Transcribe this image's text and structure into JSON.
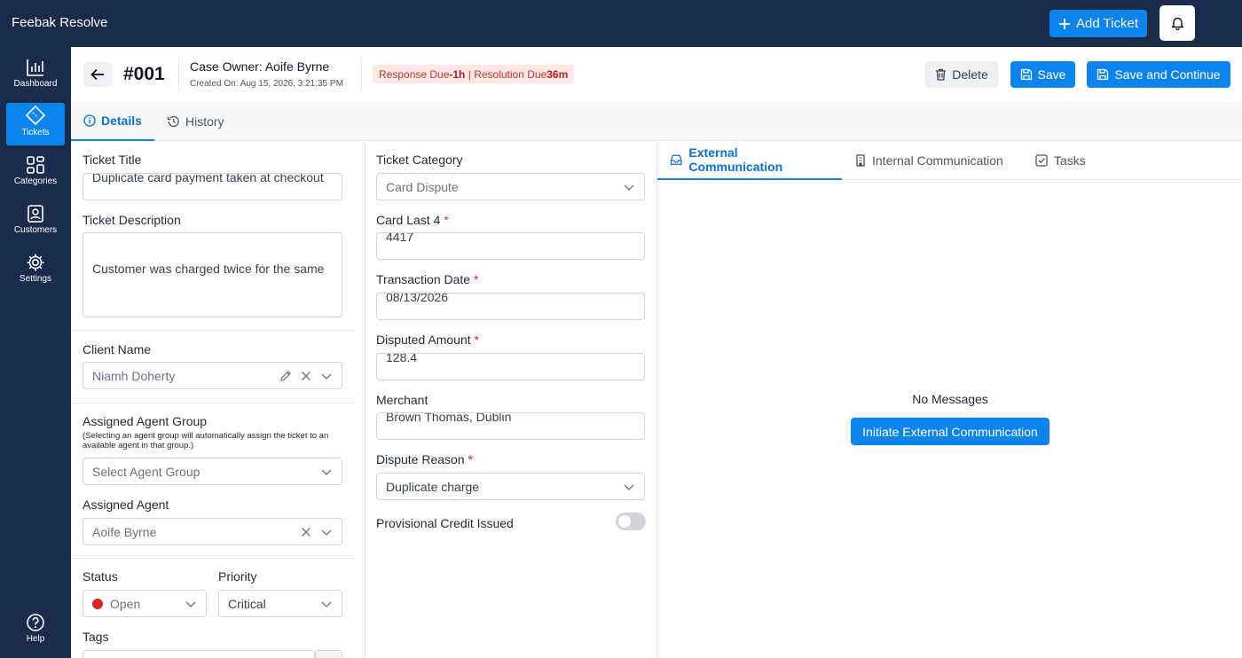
{
  "app": {
    "title": "Feebak Resolve"
  },
  "topbar": {
    "add_ticket_label": "Add Ticket"
  },
  "sidebar": {
    "items": [
      {
        "label": "Dashboard"
      },
      {
        "label": "Tickets"
      },
      {
        "label": "Categories"
      },
      {
        "label": "Customers"
      },
      {
        "label": "Settings"
      }
    ],
    "help_label": "Help"
  },
  "header": {
    "ticket_id": "#001",
    "case_owner": "Case Owner: Aoife Byrne",
    "created_on": "Created On: Aug 15, 2026, 3:21:35 PM",
    "response_due_label": "Response Due ",
    "response_due_value": "-1h",
    "separator": " | ",
    "resolution_due_label": "Resolution Due ",
    "resolution_due_value": "36m",
    "delete_label": "Delete",
    "save_label": "Save",
    "save_continue_label": "Save and Continue"
  },
  "tabs": {
    "details": "Details",
    "history": "History"
  },
  "form": {
    "ticket_title_label": "Ticket Title",
    "ticket_title_value": "Duplicate card payment taken at checkout",
    "ticket_description_label": "Ticket Description",
    "ticket_description_value": "Customer was charged twice for the same",
    "client_name_label": "Client Name",
    "client_name_value": "Niamh Doherty",
    "agent_group_label": "Assigned Agent Group",
    "agent_group_hint": "(Selecting an agent group will automatically assign the ticket to an available agent in that group.)",
    "agent_group_placeholder": "Select Agent Group",
    "assigned_agent_label": "Assigned Agent",
    "assigned_agent_value": "Aoife Byrne",
    "status_label": "Status",
    "status_value": "Open",
    "status_color": "#dc2626",
    "priority_label": "Priority",
    "priority_value": "Critical",
    "tags_label": "Tags",
    "ticket_category_label": "Ticket Category",
    "ticket_category_value": "Card Dispute",
    "card_last4_label": "Card Last 4",
    "card_last4_value": "4417",
    "transaction_date_label": "Transaction Date",
    "transaction_date_value": "08/13/2026",
    "disputed_amount_label": "Disputed Amount",
    "disputed_amount_value": "128.4",
    "merchant_label": "Merchant",
    "merchant_value": "Brown Thomas, Dublin",
    "dispute_reason_label": "Dispute Reason",
    "dispute_reason_value": "Duplicate charge",
    "provisional_credit_label": "Provisional Credit Issued",
    "required_mark": "*"
  },
  "communication": {
    "tabs": [
      "External Communication",
      "Internal Communication",
      "Tasks"
    ],
    "empty_text": "No Messages",
    "initiate_label": "Initiate External Communication"
  },
  "colors": {
    "accent": "#0b84ee",
    "navy": "#1b2b4b",
    "danger": "#dc2626"
  }
}
